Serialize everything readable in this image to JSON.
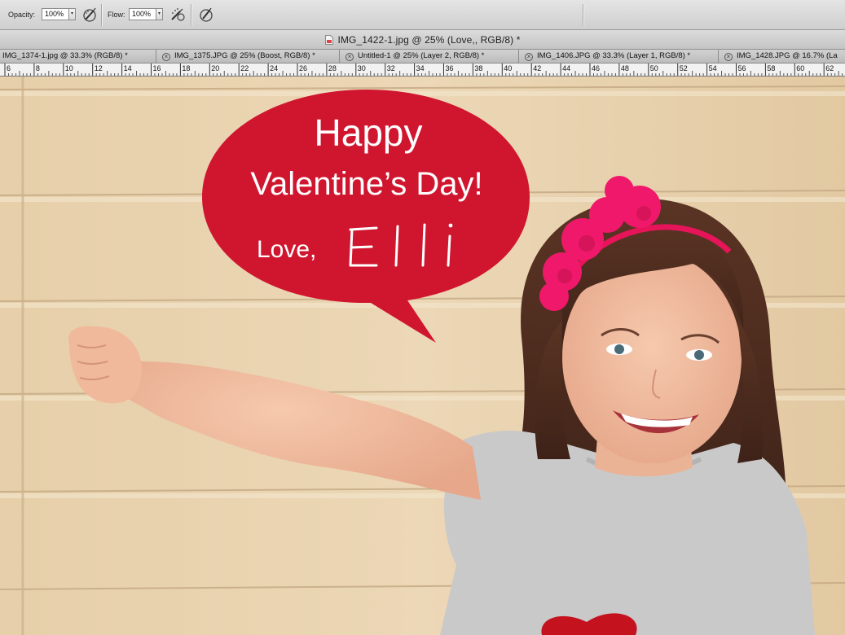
{
  "options_bar": {
    "opacity_label": "Opacity:",
    "opacity_value": "100%",
    "flow_label": "Flow:",
    "flow_value": "100%",
    "airbrush_icon": "airbrush-icon",
    "tablet_pressure_icon": "tablet-pressure-icon"
  },
  "document": {
    "title": "IMG_1422-1.jpg @ 25% (Love,, RGB/8) *"
  },
  "tabs": [
    {
      "label": "IMG_1374-1.jpg @ 33.3% (RGB/8) *",
      "closable": false
    },
    {
      "label": "IMG_1375.JPG @ 25% (Boost, RGB/8) *",
      "closable": true
    },
    {
      "label": "Untitled-1 @ 25% (Layer 2, RGB/8) *",
      "closable": true
    },
    {
      "label": "IMG_1406.JPG @ 33.3% (Layer 1, RGB/8) *",
      "closable": true
    },
    {
      "label": "IMG_1428.JPG @ 16.7% (La",
      "closable": true
    }
  ],
  "ruler": {
    "labels": [
      "6",
      "8",
      "10",
      "12",
      "14",
      "16",
      "18",
      "20",
      "22",
      "24",
      "26",
      "28",
      "30",
      "32",
      "34",
      "36",
      "38",
      "40",
      "42",
      "44",
      "46",
      "48",
      "50",
      "52",
      "54",
      "56",
      "58",
      "60",
      "62"
    ]
  },
  "speech_bubble": {
    "line1": "Happy",
    "line2": "Valentine’s Day!",
    "line3": "Love,",
    "signature": "Elli",
    "color": "#d0162f"
  },
  "colors": {
    "siding": "#e9d3b0",
    "bow": "#f0186a",
    "shirt": "#c9c9c9"
  }
}
